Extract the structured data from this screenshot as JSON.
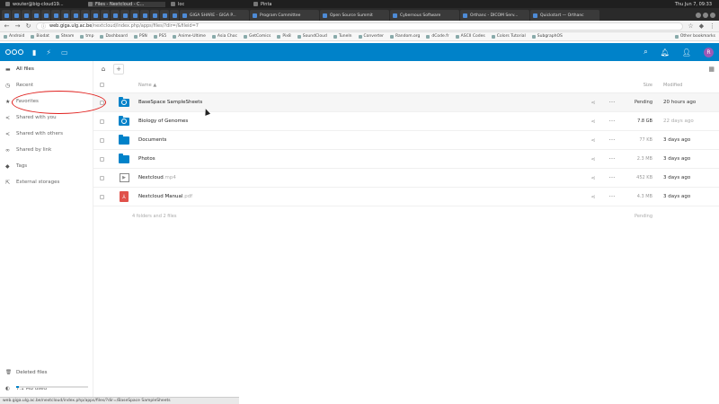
{
  "os_bar": {
    "windows": [
      "wouter@big-cloud19...",
      "Files - Nextcloud - C...",
      "loc",
      "Pinta"
    ],
    "active_index": 1,
    "clock": "Thu Jun  7, 09:33"
  },
  "browser": {
    "tabs": [
      {
        "label": "",
        "pinned": true
      },
      {
        "label": "",
        "pinned": true
      },
      {
        "label": "",
        "pinned": true
      },
      {
        "label": "",
        "pinned": true
      },
      {
        "label": "",
        "pinned": true
      },
      {
        "label": "",
        "pinned": true
      },
      {
        "label": "",
        "pinned": true
      },
      {
        "label": "",
        "pinned": true
      },
      {
        "label": "",
        "pinned": true
      },
      {
        "label": "",
        "pinned": true
      },
      {
        "label": "",
        "pinned": true
      },
      {
        "label": "",
        "pinned": true
      },
      {
        "label": "",
        "pinned": true
      },
      {
        "label": "",
        "pinned": true
      },
      {
        "label": "",
        "pinned": true
      },
      {
        "label": "",
        "pinned": true
      },
      {
        "label": "",
        "pinned": true
      },
      {
        "label": "",
        "pinned": true
      },
      {
        "label": "GIGA SHARE - GIGA P...",
        "pinned": false
      },
      {
        "label": "Program Committee",
        "pinned": false
      },
      {
        "label": "Open Source Summit",
        "pinned": false
      },
      {
        "label": "Cybernous Software",
        "pinned": false
      },
      {
        "label": "Orthanc - DICOM Serv...",
        "pinned": false
      },
      {
        "label": "Quickstart — Orthanc",
        "pinned": false
      }
    ],
    "url_host": "web.giga.ulg.ac.be",
    "url_path": "/nextcloud/index.php/apps/files/?dir=/&fileid=7",
    "bookmarks": [
      "Android",
      "Biodat",
      "Steam",
      "tmp",
      "Dashboard",
      "PSN",
      "PS5",
      "Anime-Ultime",
      "Asia Choc",
      "GetComics",
      "Pix8",
      "SoundCloud",
      "TuneIn",
      "Converter",
      "Random.org",
      "dCode.fr",
      "ASCII Codes",
      "Colors Tutorial",
      "SubgraphOS"
    ],
    "other_bookmarks": "Other bookmarks",
    "status_url": "web.giga.ulg.ac.be/nextcloud/index.php/apps/files/?dir=/BaseSpace SampleSheets"
  },
  "nextcloud": {
    "avatar_letter": "R",
    "sidebar": {
      "items": [
        {
          "label": "All files",
          "icon": "folder-icon"
        },
        {
          "label": "Recent",
          "icon": "clock-icon"
        },
        {
          "label": "Favorites",
          "icon": "star-icon"
        },
        {
          "label": "Shared with you",
          "icon": "share-icon"
        },
        {
          "label": "Shared with others",
          "icon": "share-icon"
        },
        {
          "label": "Shared by link",
          "icon": "link-icon"
        },
        {
          "label": "Tags",
          "icon": "tag-icon"
        },
        {
          "label": "External storages",
          "icon": "external-icon"
        }
      ],
      "deleted_files": "Deleted files",
      "quota": "7.1 MB used",
      "quota_fraction": 0.04
    },
    "table": {
      "col_name": "Name ▲",
      "col_size": "Size",
      "col_modified": "Modified",
      "rows": [
        {
          "name": "BaseSpace SampleSheets",
          "ext": "",
          "type": "folder-external",
          "size": "Pending",
          "modified": "20 hours ago"
        },
        {
          "name": "Biology of Genomes",
          "ext": "",
          "type": "folder-shared",
          "size": "7.8 GB",
          "modified": "22 days ago"
        },
        {
          "name": "Documents",
          "ext": "",
          "type": "folder",
          "size": "77 KB",
          "modified": "3 days ago"
        },
        {
          "name": "Photos",
          "ext": "",
          "type": "folder",
          "size": "2.3 MB",
          "modified": "3 days ago"
        },
        {
          "name": "Nextcloud",
          "ext": ".mp4",
          "type": "video",
          "size": "452 KB",
          "modified": "3 days ago"
        },
        {
          "name": "Nextcloud Manual",
          "ext": ".pdf",
          "type": "pdf",
          "size": "4.3 MB",
          "modified": "3 days ago"
        }
      ],
      "summary": "4 folders and 2 files",
      "summary_size": "Pending"
    }
  }
}
